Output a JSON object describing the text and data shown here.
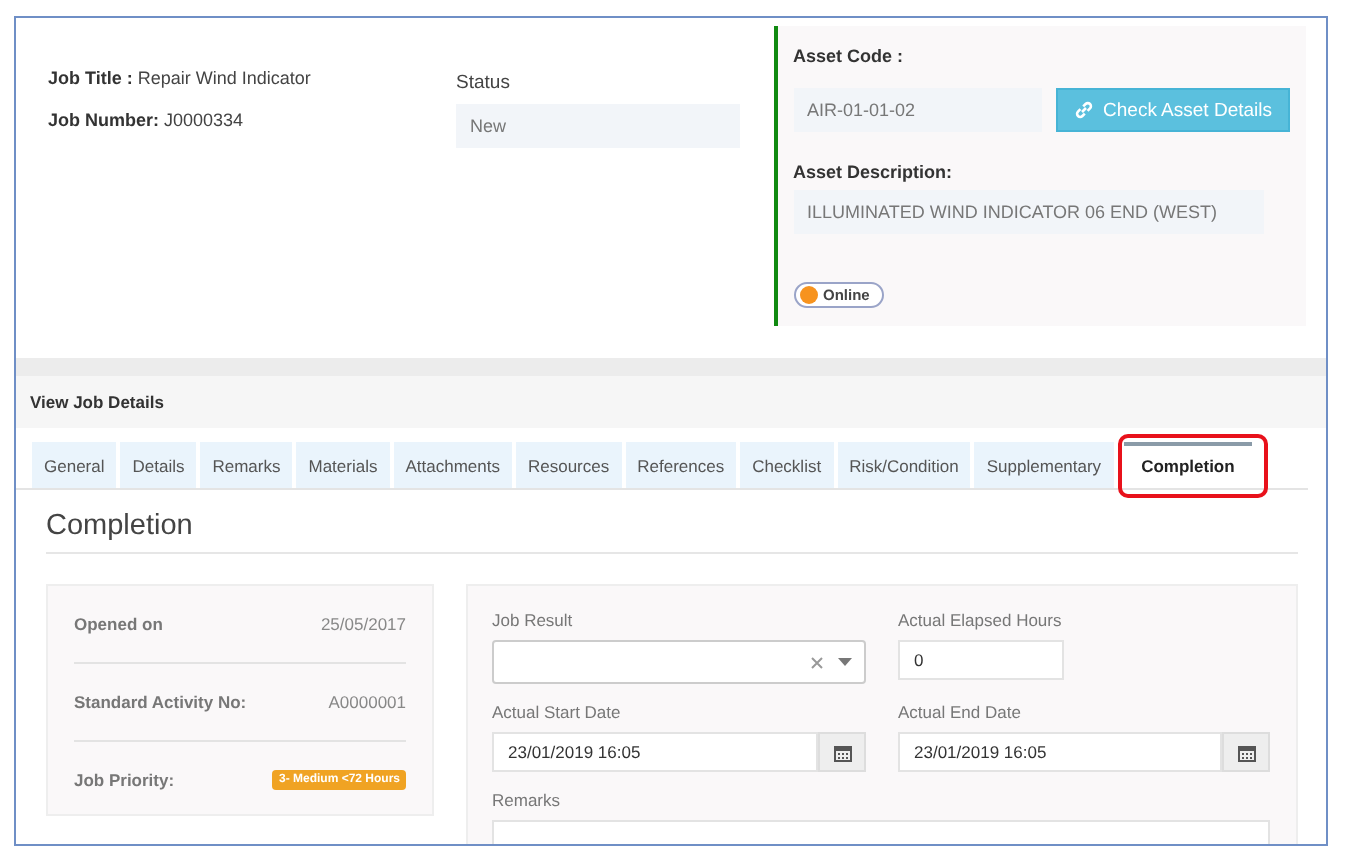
{
  "job": {
    "title_label": "Job Title :",
    "title": "Repair Wind Indicator",
    "number_label": "Job Number:",
    "number": "J0000334",
    "status_label": "Status",
    "status": "New"
  },
  "asset": {
    "code_label": "Asset Code :",
    "code": "AIR-01-01-02",
    "check_button": "Check Asset Details",
    "description_label": "Asset Description:",
    "description": "ILLUMINATED WIND INDICATOR 06 END (WEST)",
    "online_label": "Online",
    "online": true
  },
  "section_title": "View Job Details",
  "tabs": [
    {
      "label": "General",
      "selected": false,
      "annotated": false
    },
    {
      "label": "Details",
      "selected": false,
      "annotated": false
    },
    {
      "label": "Remarks",
      "selected": false,
      "annotated": false
    },
    {
      "label": "Materials",
      "selected": false,
      "annotated": false
    },
    {
      "label": "Attachments",
      "selected": false,
      "annotated": false
    },
    {
      "label": "Resources",
      "selected": false,
      "annotated": false
    },
    {
      "label": "References",
      "selected": false,
      "annotated": false
    },
    {
      "label": "Checklist",
      "selected": false,
      "annotated": false
    },
    {
      "label": "Risk/Condition",
      "selected": false,
      "annotated": false
    },
    {
      "label": "Supplementary",
      "selected": false,
      "annotated": false
    },
    {
      "label": "Completion",
      "selected": true,
      "annotated": true
    }
  ],
  "panel_title": "Completion",
  "summary": [
    {
      "label": "Opened on",
      "value": "25/05/2017",
      "kind": "text"
    },
    {
      "label": "Standard Activity No:",
      "value": "A0000001",
      "kind": "text"
    },
    {
      "label": "Job Priority:",
      "value": "3- Medium <72 Hours",
      "kind": "badge"
    }
  ],
  "form": {
    "job_result_label": "Job Result",
    "elapsed_label": "Actual Elapsed Hours",
    "elapsed": "0",
    "start_label": "Actual Start Date",
    "start": "23/01/2019 16:05",
    "end_label": "Actual End Date",
    "end": "23/01/2019 16:05",
    "remarks_label": "Remarks"
  }
}
